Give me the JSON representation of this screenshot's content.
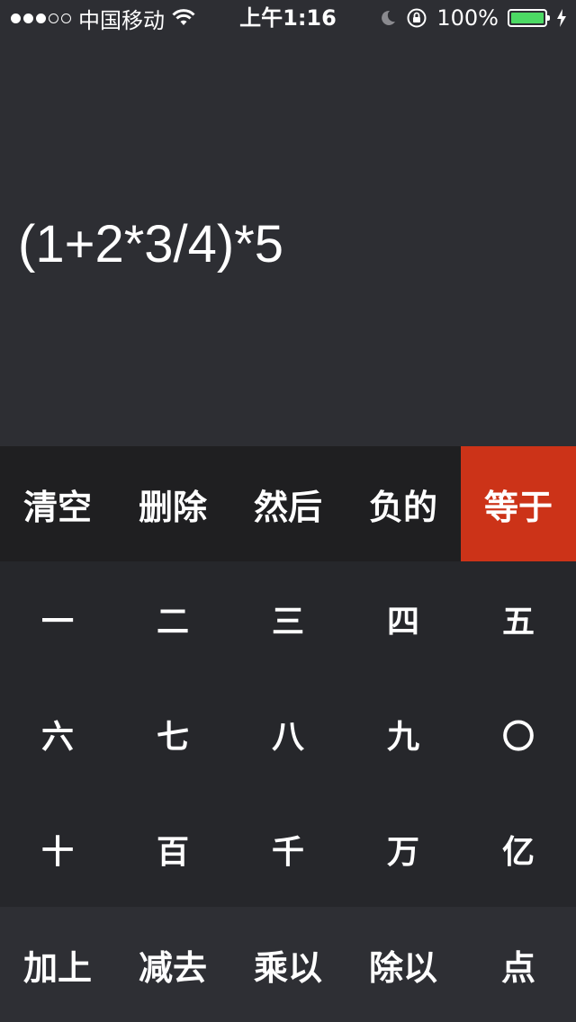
{
  "status_bar": {
    "carrier": "中国移动",
    "time": "上午1:16",
    "battery_percent": "100%",
    "battery_level": 1.0,
    "signal_bars_filled": 3,
    "signal_bars_total": 5,
    "battery_fill_color": "#4cd964"
  },
  "display": {
    "expression": "(1+2*3/4)*5"
  },
  "keypad": {
    "ops_row": [
      "清空",
      "删除",
      "然后",
      "负的",
      "等于"
    ],
    "number_rows": [
      [
        "一",
        "二",
        "三",
        "四",
        "五"
      ],
      [
        "六",
        "七",
        "八",
        "九",
        "〇"
      ],
      [
        "十",
        "百",
        "千",
        "万",
        "亿"
      ]
    ],
    "arith_row": [
      "加上",
      "减去",
      "乘以",
      "除以",
      "点"
    ]
  },
  "colors": {
    "background": "#2d2e33",
    "ops_row": "#1f1f21",
    "number_rows": "#26272b",
    "arith_row": "#2e2f34",
    "equals_accent": "#cc3318"
  }
}
